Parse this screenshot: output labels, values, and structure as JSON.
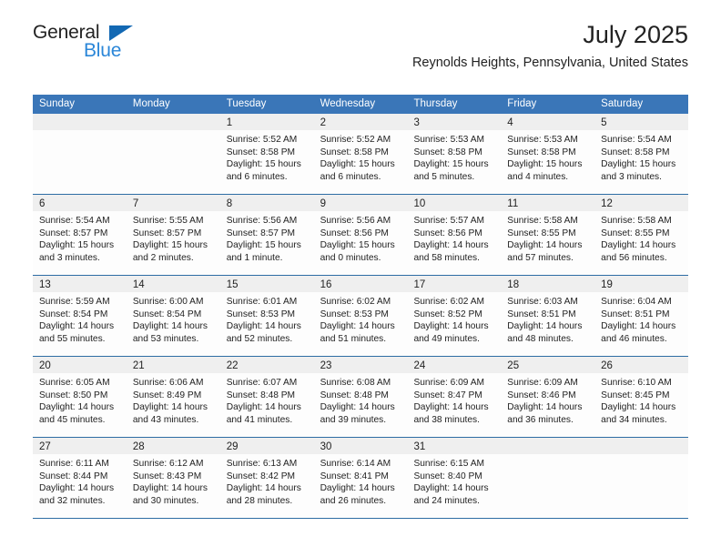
{
  "brand": {
    "name_part1": "General",
    "name_part2": "Blue",
    "triangle_color": "#1268b3",
    "blue_color": "#2a86d8"
  },
  "header": {
    "title": "July 2025",
    "subtitle": "Reynolds Heights, Pennsylvania, United States"
  },
  "theme": {
    "header_blue": "#3a76b8",
    "rule_blue": "#2e6da4",
    "daynum_band": "#efefef",
    "cell_background": "#fdfdfd",
    "text": "#222222"
  },
  "weekdays": [
    "Sunday",
    "Monday",
    "Tuesday",
    "Wednesday",
    "Thursday",
    "Friday",
    "Saturday"
  ],
  "weeks": [
    [
      {
        "day": "",
        "sunrise": "",
        "sunset": "",
        "daylight_line1": "",
        "daylight_line2": ""
      },
      {
        "day": "",
        "sunrise": "",
        "sunset": "",
        "daylight_line1": "",
        "daylight_line2": ""
      },
      {
        "day": "1",
        "sunrise": "Sunrise: 5:52 AM",
        "sunset": "Sunset: 8:58 PM",
        "daylight_line1": "Daylight: 15 hours",
        "daylight_line2": "and 6 minutes."
      },
      {
        "day": "2",
        "sunrise": "Sunrise: 5:52 AM",
        "sunset": "Sunset: 8:58 PM",
        "daylight_line1": "Daylight: 15 hours",
        "daylight_line2": "and 6 minutes."
      },
      {
        "day": "3",
        "sunrise": "Sunrise: 5:53 AM",
        "sunset": "Sunset: 8:58 PM",
        "daylight_line1": "Daylight: 15 hours",
        "daylight_line2": "and 5 minutes."
      },
      {
        "day": "4",
        "sunrise": "Sunrise: 5:53 AM",
        "sunset": "Sunset: 8:58 PM",
        "daylight_line1": "Daylight: 15 hours",
        "daylight_line2": "and 4 minutes."
      },
      {
        "day": "5",
        "sunrise": "Sunrise: 5:54 AM",
        "sunset": "Sunset: 8:58 PM",
        "daylight_line1": "Daylight: 15 hours",
        "daylight_line2": "and 3 minutes."
      }
    ],
    [
      {
        "day": "6",
        "sunrise": "Sunrise: 5:54 AM",
        "sunset": "Sunset: 8:57 PM",
        "daylight_line1": "Daylight: 15 hours",
        "daylight_line2": "and 3 minutes."
      },
      {
        "day": "7",
        "sunrise": "Sunrise: 5:55 AM",
        "sunset": "Sunset: 8:57 PM",
        "daylight_line1": "Daylight: 15 hours",
        "daylight_line2": "and 2 minutes."
      },
      {
        "day": "8",
        "sunrise": "Sunrise: 5:56 AM",
        "sunset": "Sunset: 8:57 PM",
        "daylight_line1": "Daylight: 15 hours",
        "daylight_line2": "and 1 minute."
      },
      {
        "day": "9",
        "sunrise": "Sunrise: 5:56 AM",
        "sunset": "Sunset: 8:56 PM",
        "daylight_line1": "Daylight: 15 hours",
        "daylight_line2": "and 0 minutes."
      },
      {
        "day": "10",
        "sunrise": "Sunrise: 5:57 AM",
        "sunset": "Sunset: 8:56 PM",
        "daylight_line1": "Daylight: 14 hours",
        "daylight_line2": "and 58 minutes."
      },
      {
        "day": "11",
        "sunrise": "Sunrise: 5:58 AM",
        "sunset": "Sunset: 8:55 PM",
        "daylight_line1": "Daylight: 14 hours",
        "daylight_line2": "and 57 minutes."
      },
      {
        "day": "12",
        "sunrise": "Sunrise: 5:58 AM",
        "sunset": "Sunset: 8:55 PM",
        "daylight_line1": "Daylight: 14 hours",
        "daylight_line2": "and 56 minutes."
      }
    ],
    [
      {
        "day": "13",
        "sunrise": "Sunrise: 5:59 AM",
        "sunset": "Sunset: 8:54 PM",
        "daylight_line1": "Daylight: 14 hours",
        "daylight_line2": "and 55 minutes."
      },
      {
        "day": "14",
        "sunrise": "Sunrise: 6:00 AM",
        "sunset": "Sunset: 8:54 PM",
        "daylight_line1": "Daylight: 14 hours",
        "daylight_line2": "and 53 minutes."
      },
      {
        "day": "15",
        "sunrise": "Sunrise: 6:01 AM",
        "sunset": "Sunset: 8:53 PM",
        "daylight_line1": "Daylight: 14 hours",
        "daylight_line2": "and 52 minutes."
      },
      {
        "day": "16",
        "sunrise": "Sunrise: 6:02 AM",
        "sunset": "Sunset: 8:53 PM",
        "daylight_line1": "Daylight: 14 hours",
        "daylight_line2": "and 51 minutes."
      },
      {
        "day": "17",
        "sunrise": "Sunrise: 6:02 AM",
        "sunset": "Sunset: 8:52 PM",
        "daylight_line1": "Daylight: 14 hours",
        "daylight_line2": "and 49 minutes."
      },
      {
        "day": "18",
        "sunrise": "Sunrise: 6:03 AM",
        "sunset": "Sunset: 8:51 PM",
        "daylight_line1": "Daylight: 14 hours",
        "daylight_line2": "and 48 minutes."
      },
      {
        "day": "19",
        "sunrise": "Sunrise: 6:04 AM",
        "sunset": "Sunset: 8:51 PM",
        "daylight_line1": "Daylight: 14 hours",
        "daylight_line2": "and 46 minutes."
      }
    ],
    [
      {
        "day": "20",
        "sunrise": "Sunrise: 6:05 AM",
        "sunset": "Sunset: 8:50 PM",
        "daylight_line1": "Daylight: 14 hours",
        "daylight_line2": "and 45 minutes."
      },
      {
        "day": "21",
        "sunrise": "Sunrise: 6:06 AM",
        "sunset": "Sunset: 8:49 PM",
        "daylight_line1": "Daylight: 14 hours",
        "daylight_line2": "and 43 minutes."
      },
      {
        "day": "22",
        "sunrise": "Sunrise: 6:07 AM",
        "sunset": "Sunset: 8:48 PM",
        "daylight_line1": "Daylight: 14 hours",
        "daylight_line2": "and 41 minutes."
      },
      {
        "day": "23",
        "sunrise": "Sunrise: 6:08 AM",
        "sunset": "Sunset: 8:48 PM",
        "daylight_line1": "Daylight: 14 hours",
        "daylight_line2": "and 39 minutes."
      },
      {
        "day": "24",
        "sunrise": "Sunrise: 6:09 AM",
        "sunset": "Sunset: 8:47 PM",
        "daylight_line1": "Daylight: 14 hours",
        "daylight_line2": "and 38 minutes."
      },
      {
        "day": "25",
        "sunrise": "Sunrise: 6:09 AM",
        "sunset": "Sunset: 8:46 PM",
        "daylight_line1": "Daylight: 14 hours",
        "daylight_line2": "and 36 minutes."
      },
      {
        "day": "26",
        "sunrise": "Sunrise: 6:10 AM",
        "sunset": "Sunset: 8:45 PM",
        "daylight_line1": "Daylight: 14 hours",
        "daylight_line2": "and 34 minutes."
      }
    ],
    [
      {
        "day": "27",
        "sunrise": "Sunrise: 6:11 AM",
        "sunset": "Sunset: 8:44 PM",
        "daylight_line1": "Daylight: 14 hours",
        "daylight_line2": "and 32 minutes."
      },
      {
        "day": "28",
        "sunrise": "Sunrise: 6:12 AM",
        "sunset": "Sunset: 8:43 PM",
        "daylight_line1": "Daylight: 14 hours",
        "daylight_line2": "and 30 minutes."
      },
      {
        "day": "29",
        "sunrise": "Sunrise: 6:13 AM",
        "sunset": "Sunset: 8:42 PM",
        "daylight_line1": "Daylight: 14 hours",
        "daylight_line2": "and 28 minutes."
      },
      {
        "day": "30",
        "sunrise": "Sunrise: 6:14 AM",
        "sunset": "Sunset: 8:41 PM",
        "daylight_line1": "Daylight: 14 hours",
        "daylight_line2": "and 26 minutes."
      },
      {
        "day": "31",
        "sunrise": "Sunrise: 6:15 AM",
        "sunset": "Sunset: 8:40 PM",
        "daylight_line1": "Daylight: 14 hours",
        "daylight_line2": "and 24 minutes."
      },
      {
        "day": "",
        "sunrise": "",
        "sunset": "",
        "daylight_line1": "",
        "daylight_line2": ""
      },
      {
        "day": "",
        "sunrise": "",
        "sunset": "",
        "daylight_line1": "",
        "daylight_line2": ""
      }
    ]
  ]
}
